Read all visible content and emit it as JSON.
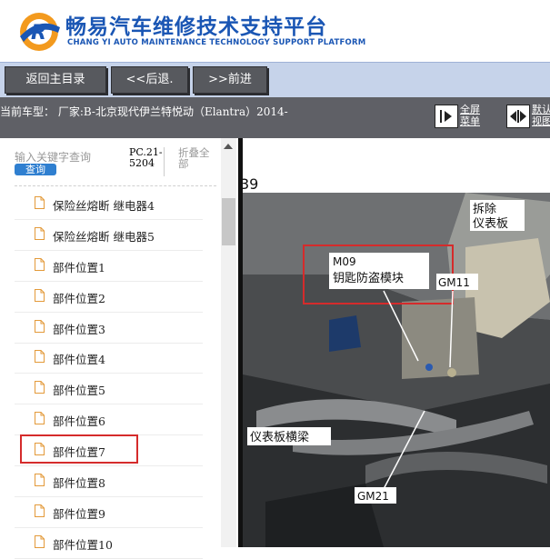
{
  "header": {
    "brand_cn": "畅易汽车维修技术支持平台",
    "brand_en": "CHANG YI AUTO MAINTENANCE TECHNOLOGY SUPPORT PLATFORM",
    "logo_letter": "R"
  },
  "nav": {
    "home": "返回主目录",
    "back": "<<后退.",
    "forward": ">>前进"
  },
  "vehicle_bar": {
    "text": "当前车型：  厂家:B-北京现代伊兰特悦动（Elantra）2014-",
    "fullscreen": [
      "全屏",
      "菜单"
    ],
    "default_view": [
      "默认",
      "视图"
    ]
  },
  "sidebar": {
    "search_placeholder": "输入关键字查询",
    "query_button": "查询",
    "pc_number": "PC.21-5204",
    "collapse_all": "折叠全部",
    "items": [
      {
        "label": "保险丝熔断 继电器4"
      },
      {
        "label": "保险丝熔断 继电器5"
      },
      {
        "label": "部件位置1"
      },
      {
        "label": "部件位置2"
      },
      {
        "label": "部件位置3"
      },
      {
        "label": "部件位置4"
      },
      {
        "label": "部件位置5"
      },
      {
        "label": "部件位置6"
      },
      {
        "label": "部件位置7",
        "highlighted": true
      },
      {
        "label": "部件位置8"
      },
      {
        "label": "部件位置9"
      },
      {
        "label": "部件位置10"
      }
    ]
  },
  "diagram": {
    "page_no": "39",
    "callout_m09_code": "M09",
    "callout_m09_name": "钥匙防盗模块",
    "callout_gm11": "GM11",
    "callout_panel_1": "拆除",
    "callout_panel_2": "仪表板",
    "callout_beam": "仪表板横梁",
    "callout_gm21": "GM21"
  },
  "colors": {
    "brand_blue": "#1a56b4",
    "nav_bg": "#c6d3ea",
    "nav_button": "#57595e",
    "vehicle_bar": "#5f6066",
    "highlight_red": "#d52b2b",
    "query_blue": "#2f7fd0"
  }
}
